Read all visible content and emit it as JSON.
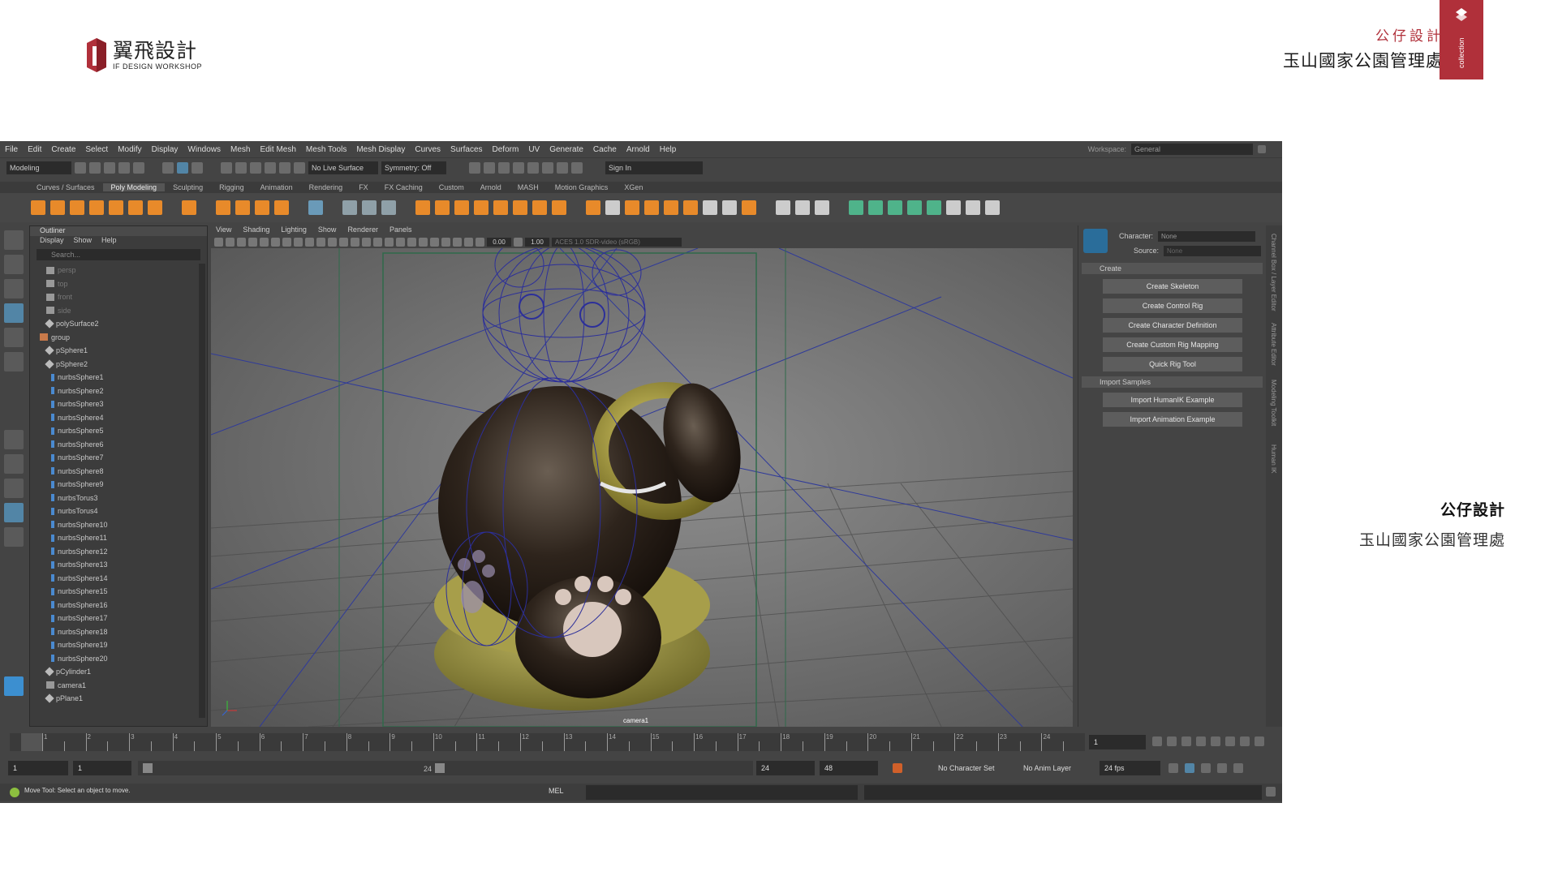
{
  "brand": {
    "name_zh": "翼飛設計",
    "name_en": "IF DESIGN WORKSHOP"
  },
  "header": {
    "company": "公仔設計",
    "client": "玉山國家公園管理處",
    "tag": "collection"
  },
  "side_note": {
    "company": "公仔設計",
    "client": "玉山國家公園管理處"
  },
  "maya": {
    "menus": [
      "File",
      "Edit",
      "Create",
      "Select",
      "Modify",
      "Display",
      "Windows",
      "Mesh",
      "Edit Mesh",
      "Mesh Tools",
      "Mesh Display",
      "Curves",
      "Surfaces",
      "Deform",
      "UV",
      "Generate",
      "Cache",
      "Arnold",
      "Help"
    ],
    "workspace_label": "Workspace:",
    "workspace_value": "General",
    "menuset": "Modeling",
    "live_surface": "No Live Surface",
    "symmetry": "Symmetry: Off",
    "sign_in": "Sign In",
    "shelf_tabs": [
      "Curves / Surfaces",
      "Poly Modeling",
      "Sculpting",
      "Rigging",
      "Animation",
      "Rendering",
      "FX",
      "FX Caching",
      "Custom",
      "Arnold",
      "MASH",
      "Motion Graphics",
      "XGen"
    ],
    "active_shelf": "Poly Modeling",
    "outliner": {
      "title": "Outliner",
      "menu": [
        "Display",
        "Show",
        "Help"
      ],
      "search_placeholder": "Search...",
      "items": [
        {
          "name": "persp",
          "type": "camera",
          "dim": true
        },
        {
          "name": "top",
          "type": "camera",
          "dim": true
        },
        {
          "name": "front",
          "type": "camera",
          "dim": true
        },
        {
          "name": "side",
          "type": "camera",
          "dim": true
        },
        {
          "name": "polySurface2",
          "type": "mesh"
        },
        {
          "name": "group",
          "type": "group"
        },
        {
          "name": "pSphere1",
          "type": "mesh"
        },
        {
          "name": "pSphere2",
          "type": "mesh"
        },
        {
          "name": "nurbsSphere1",
          "type": "nurbs"
        },
        {
          "name": "nurbsSphere2",
          "type": "nurbs"
        },
        {
          "name": "nurbsSphere3",
          "type": "nurbs"
        },
        {
          "name": "nurbsSphere4",
          "type": "nurbs"
        },
        {
          "name": "nurbsSphere5",
          "type": "nurbs"
        },
        {
          "name": "nurbsSphere6",
          "type": "nurbs"
        },
        {
          "name": "nurbsSphere7",
          "type": "nurbs"
        },
        {
          "name": "nurbsSphere8",
          "type": "nurbs"
        },
        {
          "name": "nurbsSphere9",
          "type": "nurbs"
        },
        {
          "name": "nurbsTorus3",
          "type": "nurbs"
        },
        {
          "name": "nurbsTorus4",
          "type": "nurbs"
        },
        {
          "name": "nurbsSphere10",
          "type": "nurbs"
        },
        {
          "name": "nurbsSphere11",
          "type": "nurbs"
        },
        {
          "name": "nurbsSphere12",
          "type": "nurbs"
        },
        {
          "name": "nurbsSphere13",
          "type": "nurbs"
        },
        {
          "name": "nurbsSphere14",
          "type": "nurbs"
        },
        {
          "name": "nurbsSphere15",
          "type": "nurbs"
        },
        {
          "name": "nurbsSphere16",
          "type": "nurbs"
        },
        {
          "name": "nurbsSphere17",
          "type": "nurbs"
        },
        {
          "name": "nurbsSphere18",
          "type": "nurbs"
        },
        {
          "name": "nurbsSphere19",
          "type": "nurbs"
        },
        {
          "name": "nurbsSphere20",
          "type": "nurbs"
        },
        {
          "name": "pCylinder1",
          "type": "mesh"
        },
        {
          "name": "camera1",
          "type": "camera"
        },
        {
          "name": "pPlane1",
          "type": "mesh"
        }
      ]
    },
    "viewport": {
      "menu": [
        "View",
        "Shading",
        "Lighting",
        "Show",
        "Renderer",
        "Panels"
      ],
      "field1": "0.00",
      "field2": "1.00",
      "colorspace": "ACES 1.0 SDR-video (sRGB)",
      "camera_label": "camera1"
    },
    "hik": {
      "character_label": "Character:",
      "character_value": "None",
      "source_label": "Source:",
      "source_value": "None",
      "section_create": "Create",
      "create_buttons": [
        "Create Skeleton",
        "Create Control Rig",
        "Create Character Definition",
        "Create Custom Rig Mapping",
        "Quick Rig Tool"
      ],
      "section_import": "Import Samples",
      "import_buttons": [
        "Import HumanIK Example",
        "Import Animation Example"
      ]
    },
    "side_tabs": [
      "Channel Box / Layer Editor",
      "Attribute Editor",
      "Modeling Toolkit",
      "Human IK"
    ],
    "timeline": {
      "ticks": [
        "1",
        "2",
        "3",
        "4",
        "5",
        "6",
        "7",
        "8",
        "9",
        "10",
        "11",
        "12",
        "13",
        "14",
        "15",
        "16",
        "17",
        "18",
        "19",
        "20",
        "21",
        "22",
        "23",
        "24"
      ],
      "current_frame": "1"
    },
    "range": {
      "start": "1",
      "playback_start": "1",
      "range_start_handle": "",
      "range_end_handle": "24",
      "playback_end": "24",
      "end": "48",
      "character_set": "No Character Set",
      "anim_layer": "No Anim Layer",
      "fps": "24 fps"
    },
    "cmd": {
      "language": "MEL",
      "help": "Move Tool: Select an object to move."
    }
  }
}
